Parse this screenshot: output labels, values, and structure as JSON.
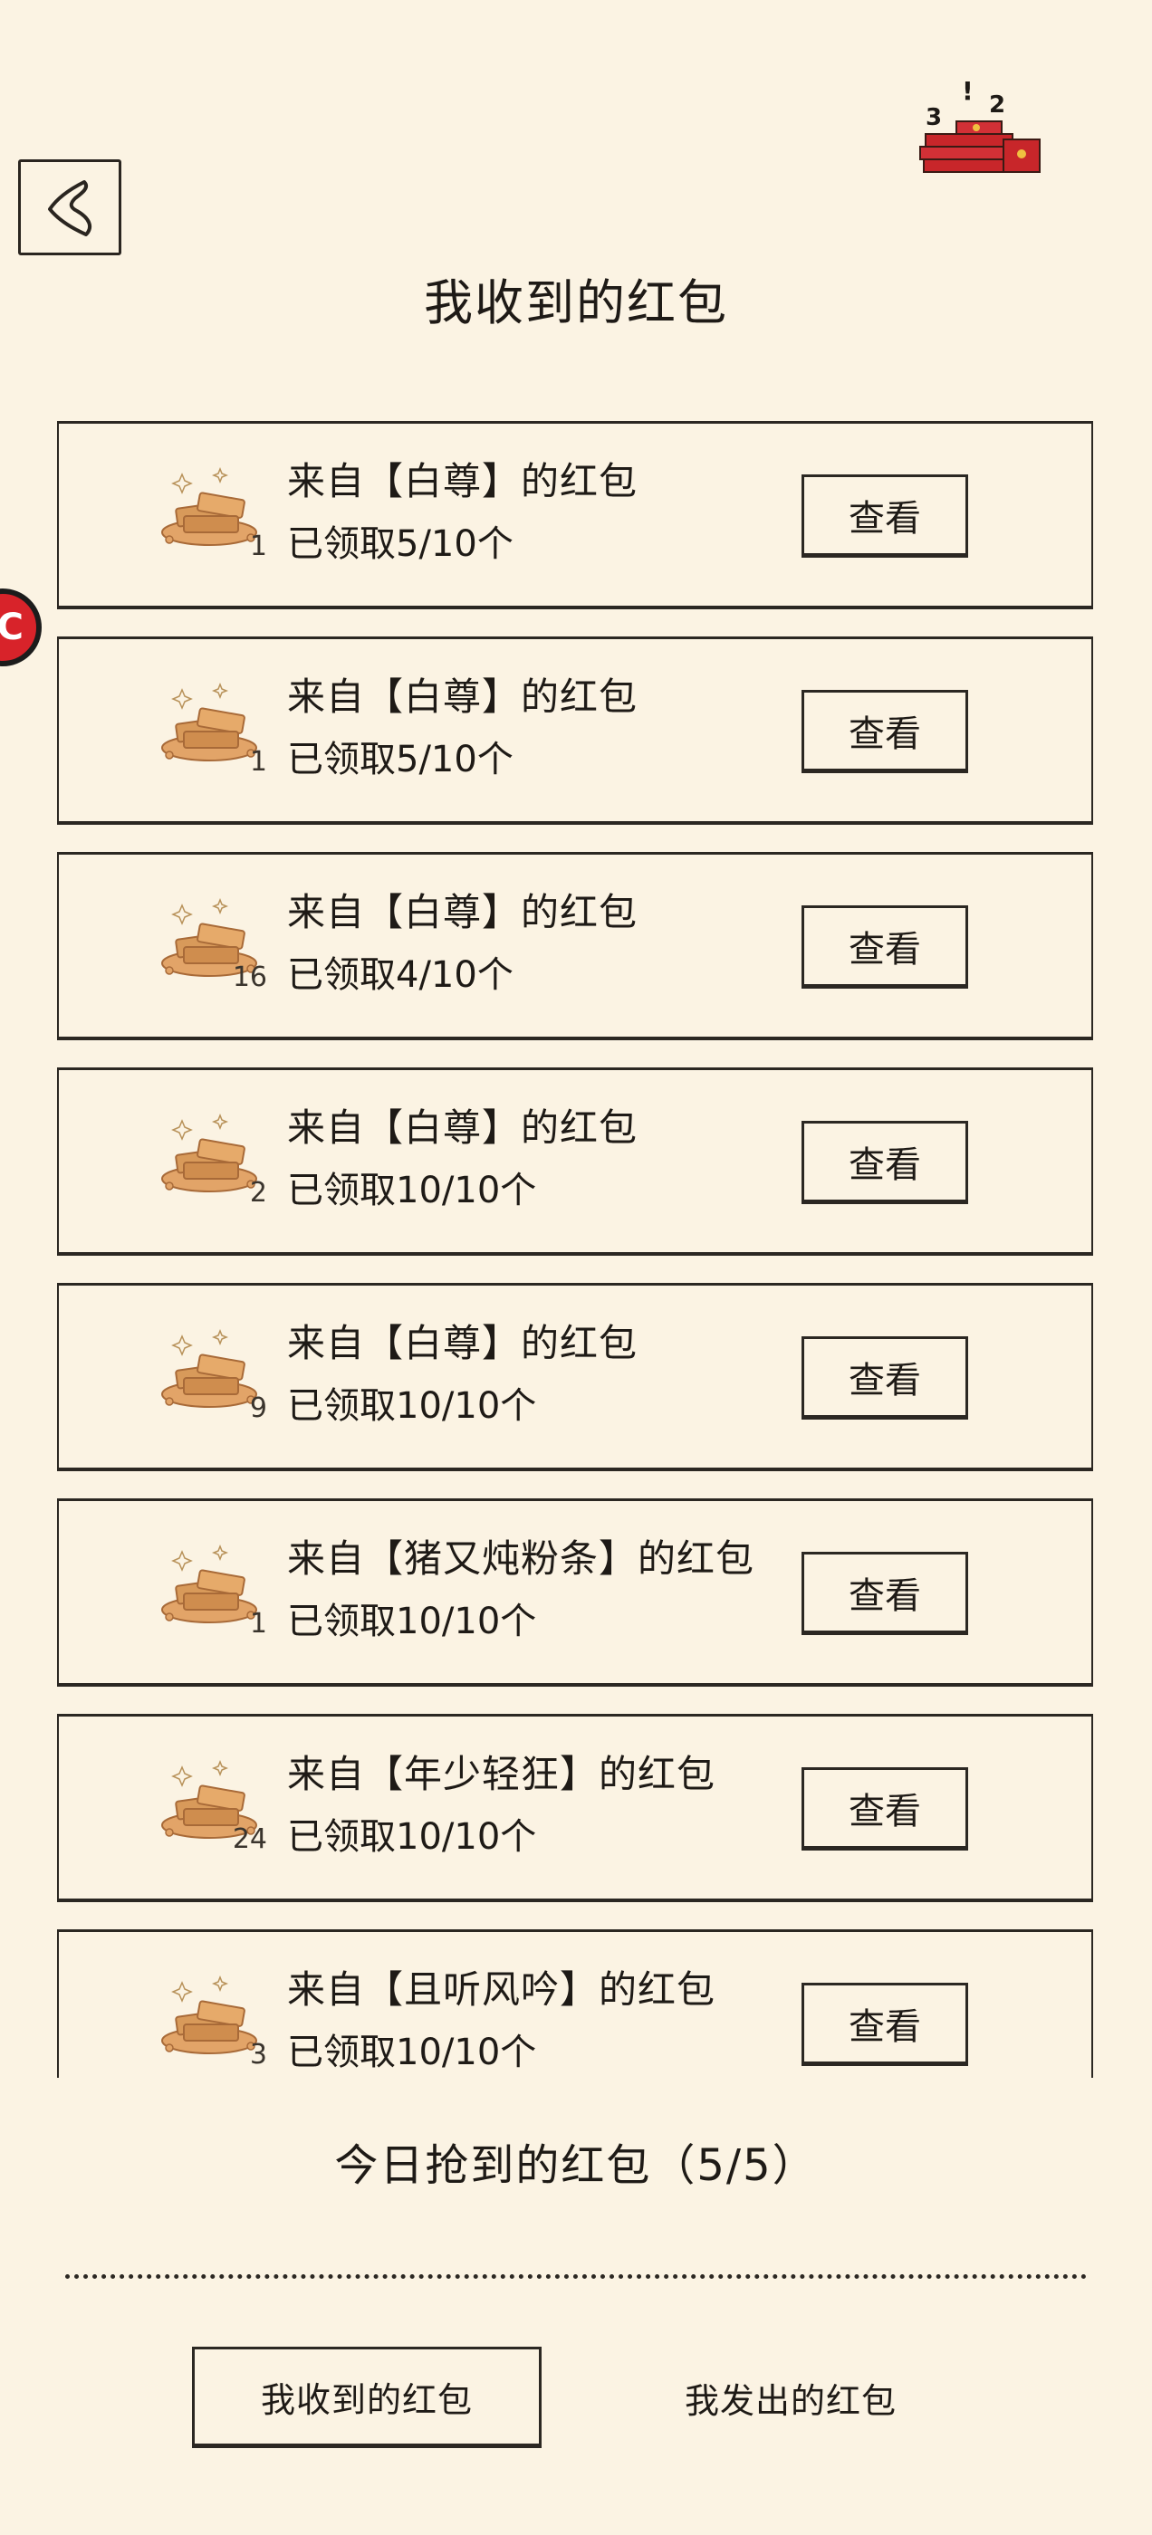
{
  "header": {
    "title": "我收到的红包",
    "back_icon": "chevron-left-icon",
    "decoration_icon": "red-envelope-stack-icon",
    "decoration_marks": [
      "3",
      "!",
      "2"
    ]
  },
  "side_tab": {
    "glyph": "C",
    "color": "#d8232a"
  },
  "items": [
    {
      "title": "来自【白尊】的红包",
      "progress": "已领取5/10个",
      "gold_count": "1",
      "button": "查看"
    },
    {
      "title": "来自【白尊】的红包",
      "progress": "已领取5/10个",
      "gold_count": "1",
      "button": "查看"
    },
    {
      "title": "来自【白尊】的红包",
      "progress": "已领取4/10个",
      "gold_count": "16",
      "button": "查看"
    },
    {
      "title": "来自【白尊】的红包",
      "progress": "已领取10/10个",
      "gold_count": "2",
      "button": "查看"
    },
    {
      "title": "来自【白尊】的红包",
      "progress": "已领取10/10个",
      "gold_count": "9",
      "button": "查看"
    },
    {
      "title": "来自【猪又炖粉条】的红包",
      "progress": "已领取10/10个",
      "gold_count": "1",
      "button": "查看"
    },
    {
      "title": "来自【年少轻狂】的红包",
      "progress": "已领取10/10个",
      "gold_count": "24",
      "button": "查看"
    },
    {
      "title": "来自【且听风吟】的红包",
      "progress": "已领取10/10个",
      "gold_count": "3",
      "button": "查看"
    }
  ],
  "footer": {
    "today_label": "今日抢到的红包（5/5）",
    "tabs": [
      "我收到的红包",
      "我发出的红包"
    ],
    "active_tab": 0
  },
  "colors": {
    "background": "#fbf3e3",
    "ink": "#2b2722",
    "gold": "#d89a5a",
    "envelope_red": "#c8262a"
  }
}
